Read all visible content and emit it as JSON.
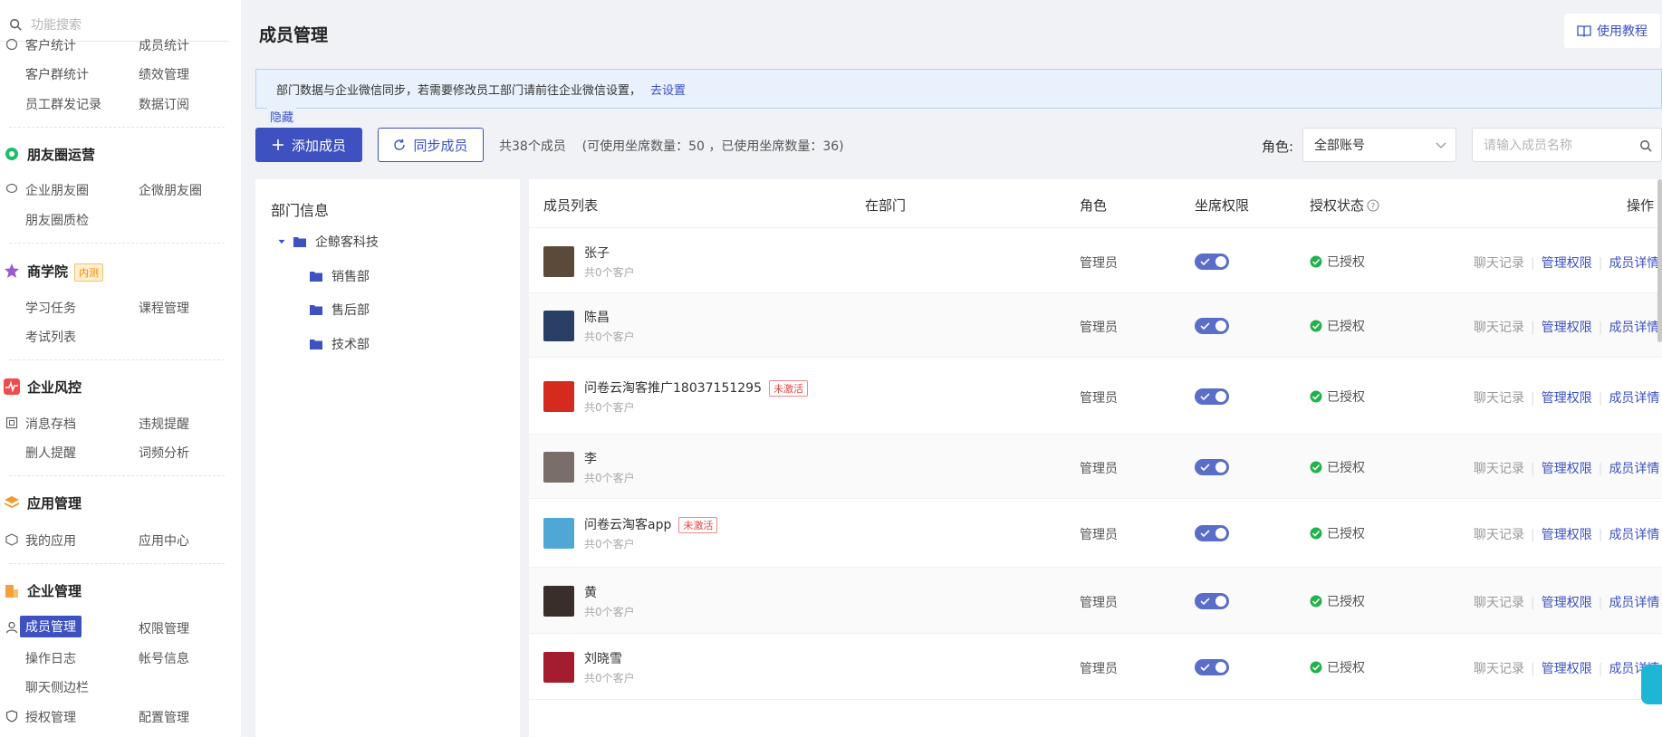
{
  "sidebar": {
    "search_placeholder": "功能搜索",
    "top_row": [
      "客户统计",
      "成员统计"
    ],
    "rows_a": [
      [
        "客户群统计",
        "绩效管理"
      ],
      [
        "员工群发记录",
        "数据订阅"
      ]
    ],
    "sec_moments": "朋友圈运营",
    "rows_moments": [
      [
        "企业朋友圈",
        "企微朋友圈"
      ],
      [
        "朋友圈质检",
        ""
      ]
    ],
    "sec_academy": "商学院",
    "academy_badge": "内测",
    "rows_academy": [
      [
        "学习任务",
        "课程管理"
      ],
      [
        "考试列表",
        ""
      ]
    ],
    "sec_risk": "企业风控",
    "rows_risk": [
      [
        "消息存档",
        "违规提醒"
      ],
      [
        "删人提醒",
        "词频分析"
      ]
    ],
    "sec_apps": "应用管理",
    "rows_apps": [
      [
        "我的应用",
        "应用中心"
      ]
    ],
    "sec_enterprise": "企业管理",
    "rows_enterprise": [
      [
        "成员管理",
        "权限管理"
      ],
      [
        "操作日志",
        "帐号信息"
      ],
      [
        "聊天侧边栏",
        ""
      ],
      [
        "授权管理",
        "配置管理"
      ]
    ],
    "colors": {
      "moments": "#1fbf6a",
      "academy": "#9b59d0",
      "risk": "#f04a4a",
      "apps": "#f39a2b",
      "enterprise": "#f3a23a",
      "active_bg": "#3d51c0"
    }
  },
  "header": {
    "title": "成员管理",
    "tutorial": "使用教程"
  },
  "notice": {
    "text": "部门数据与企业微信同步，若需要修改员工部门请前往企业微信设置，",
    "link": "去设置",
    "tail": "隐藏"
  },
  "toolbar": {
    "add_member": "添加成员",
    "sync_member": "同步成员",
    "count_text": "共38个成员    (可使用坐席数量：50 ，已使用坐席数量：36)",
    "role_label": "角色:",
    "role_value": "全部账号",
    "search_placeholder": "请输入成员名称"
  },
  "dept": {
    "title": "部门信息",
    "root": "企鲸客科技",
    "children": [
      "销售部",
      "售后部",
      "技术部"
    ]
  },
  "table": {
    "headers": [
      "成员列表",
      "在部门",
      "角色",
      "坐席权限",
      "授权状态",
      "操作"
    ],
    "ops": [
      "聊天记录",
      "管理权限",
      "成员详情"
    ],
    "rows": [
      {
        "name": "张子",
        "customers": "共0个客户",
        "role": "管理员",
        "auth": "已授权",
        "inactive": "",
        "avatar_color": "#5b4a3a"
      },
      {
        "name": "陈昌",
        "customers": "共0个客户",
        "role": "管理员",
        "auth": "已授权",
        "inactive": "",
        "avatar_color": "#2a3f66"
      },
      {
        "name": "问卷云淘客推广18037151295",
        "customers": "共0个客户",
        "role": "管理员",
        "auth": "已授权",
        "inactive": "未激活",
        "avatar_color": "#d52b1e"
      },
      {
        "name": "李",
        "customers": "共0个客户",
        "role": "管理员",
        "auth": "已授权",
        "inactive": "",
        "avatar_color": "#7a6e6a"
      },
      {
        "name": "问卷云淘客app",
        "customers": "共0个客户",
        "role": "管理员",
        "auth": "已授权",
        "inactive": "未激活",
        "avatar_color": "#4fa7d6"
      },
      {
        "name": "黄",
        "customers": "共0个客户",
        "role": "管理员",
        "auth": "已授权",
        "inactive": "",
        "avatar_color": "#3a2e2a"
      },
      {
        "name": "刘晓雪",
        "customers": "共0个客户",
        "role": "管理员",
        "auth": "已授权",
        "inactive": "",
        "avatar_color": "#a31d2e"
      }
    ]
  }
}
